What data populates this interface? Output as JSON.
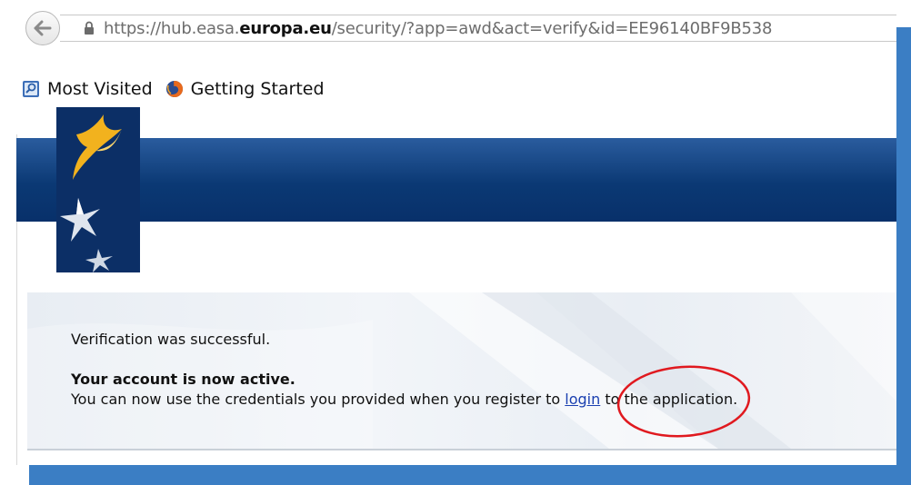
{
  "browser": {
    "url_prefix": "https://hub.easa.",
    "url_domain": "europa.eu",
    "url_suffix": "/security/?app=awd&act=verify&id=EE96140BF9B538",
    "bookmarks": [
      {
        "label": "Most Visited",
        "icon": "bookmarks-icon"
      },
      {
        "label": "Getting Started",
        "icon": "firefox-icon"
      }
    ]
  },
  "page": {
    "verified_text": "Verification was successful.",
    "active_text": "Your account is now active.",
    "instructions_before": "You can now use the credentials you provided when you register to ",
    "login_link": "login",
    "instructions_after": " to the application."
  },
  "colors": {
    "frame_blue": "#3b7ec4",
    "banner_blue": "#0b3974",
    "link_blue": "#1a3fb0",
    "annotation_red": "#e0191f",
    "logo_gold": "#f2b21e"
  }
}
